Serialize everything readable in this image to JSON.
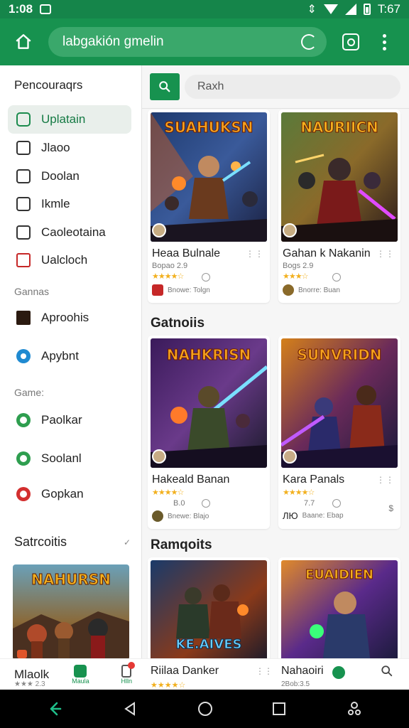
{
  "status_bar": {
    "time": "1:08",
    "right_time": "T:67"
  },
  "app_bar": {
    "url_text": "labgakión gmelin"
  },
  "sidebar": {
    "heading": "Pencouraqrs",
    "items_top": [
      {
        "label": "Uplatain",
        "icon": "gamepad-icon",
        "active": true
      },
      {
        "label": "Jlaoo",
        "icon": "square-icon"
      },
      {
        "label": "Doolan",
        "icon": "list-icon"
      },
      {
        "label": "Ikmle",
        "icon": "puzzle-icon"
      },
      {
        "label": "Caoleotaina",
        "icon": "user-group-icon"
      },
      {
        "label": "Ualcloch",
        "icon": "calendar-icon"
      }
    ],
    "section_games_1": "Gannas",
    "items_games_1": [
      {
        "label": "Aproohis",
        "icon": "game-thumb-icon"
      },
      {
        "label": "Apybnt",
        "icon": "circle-target-icon"
      }
    ],
    "section_games_2": "Game:",
    "items_games_2": [
      {
        "label": "Paolkar",
        "icon": "green-heart-icon"
      },
      {
        "label": "Soolanl",
        "icon": "green-circle-icon"
      },
      {
        "label": "Gopkan",
        "icon": "red-circle-icon"
      }
    ],
    "collapse_label": "Satrcoitis",
    "feature_title": "NAHURSN",
    "bottom": {
      "label": "Mlaolk",
      "sub": "★★★ 2.3",
      "mid_caption": "Maula",
      "right_caption": "Hlln"
    }
  },
  "main": {
    "search_placeholder": "Raxh",
    "row1": [
      {
        "art_title": "SUAHUKSN",
        "title": "Heaa Bulnale",
        "rating": "Bopao 2.9",
        "stars": "★★★★☆",
        "dev": "Bnowe: Tolgn",
        "more": "⋮⋮"
      },
      {
        "art_title": "NAURIICN",
        "title": "Gahan k Nakanin",
        "rating": "Bogs 2.9",
        "stars": "★★★☆",
        "dev": "Bnorre: Buan",
        "more": "⋮⋮"
      }
    ],
    "section2_title": "Gatnoiis",
    "row2": [
      {
        "art_title": "NAHKRISN",
        "title": "Hakeald Banan",
        "rating": "B.0",
        "stars": "★★★★☆",
        "dev": "Bnewe: Blajo",
        "more": ""
      },
      {
        "art_title": "SUNVRIDN",
        "title": "Kara Panals",
        "rating": "7.7",
        "stars": "★★★★☆",
        "dev": "Baane: Ebap",
        "more": "⋮⋮",
        "dev_prefix": "ЛЮ"
      }
    ],
    "section3_title": "Ramqoits",
    "row3": [
      {
        "art_title": "KE.AIVES"
      },
      {
        "art_title": "EUAIDIEN"
      }
    ],
    "bottom_strip": [
      {
        "title": "Riilaa Danker",
        "stars": "★★★★☆"
      },
      {
        "title": "Nahaoiri",
        "sub": "2Bob:3.5"
      }
    ]
  },
  "colors": {
    "primary": "#17924f",
    "status": "#15854a",
    "accent_star": "#f2b01e"
  }
}
